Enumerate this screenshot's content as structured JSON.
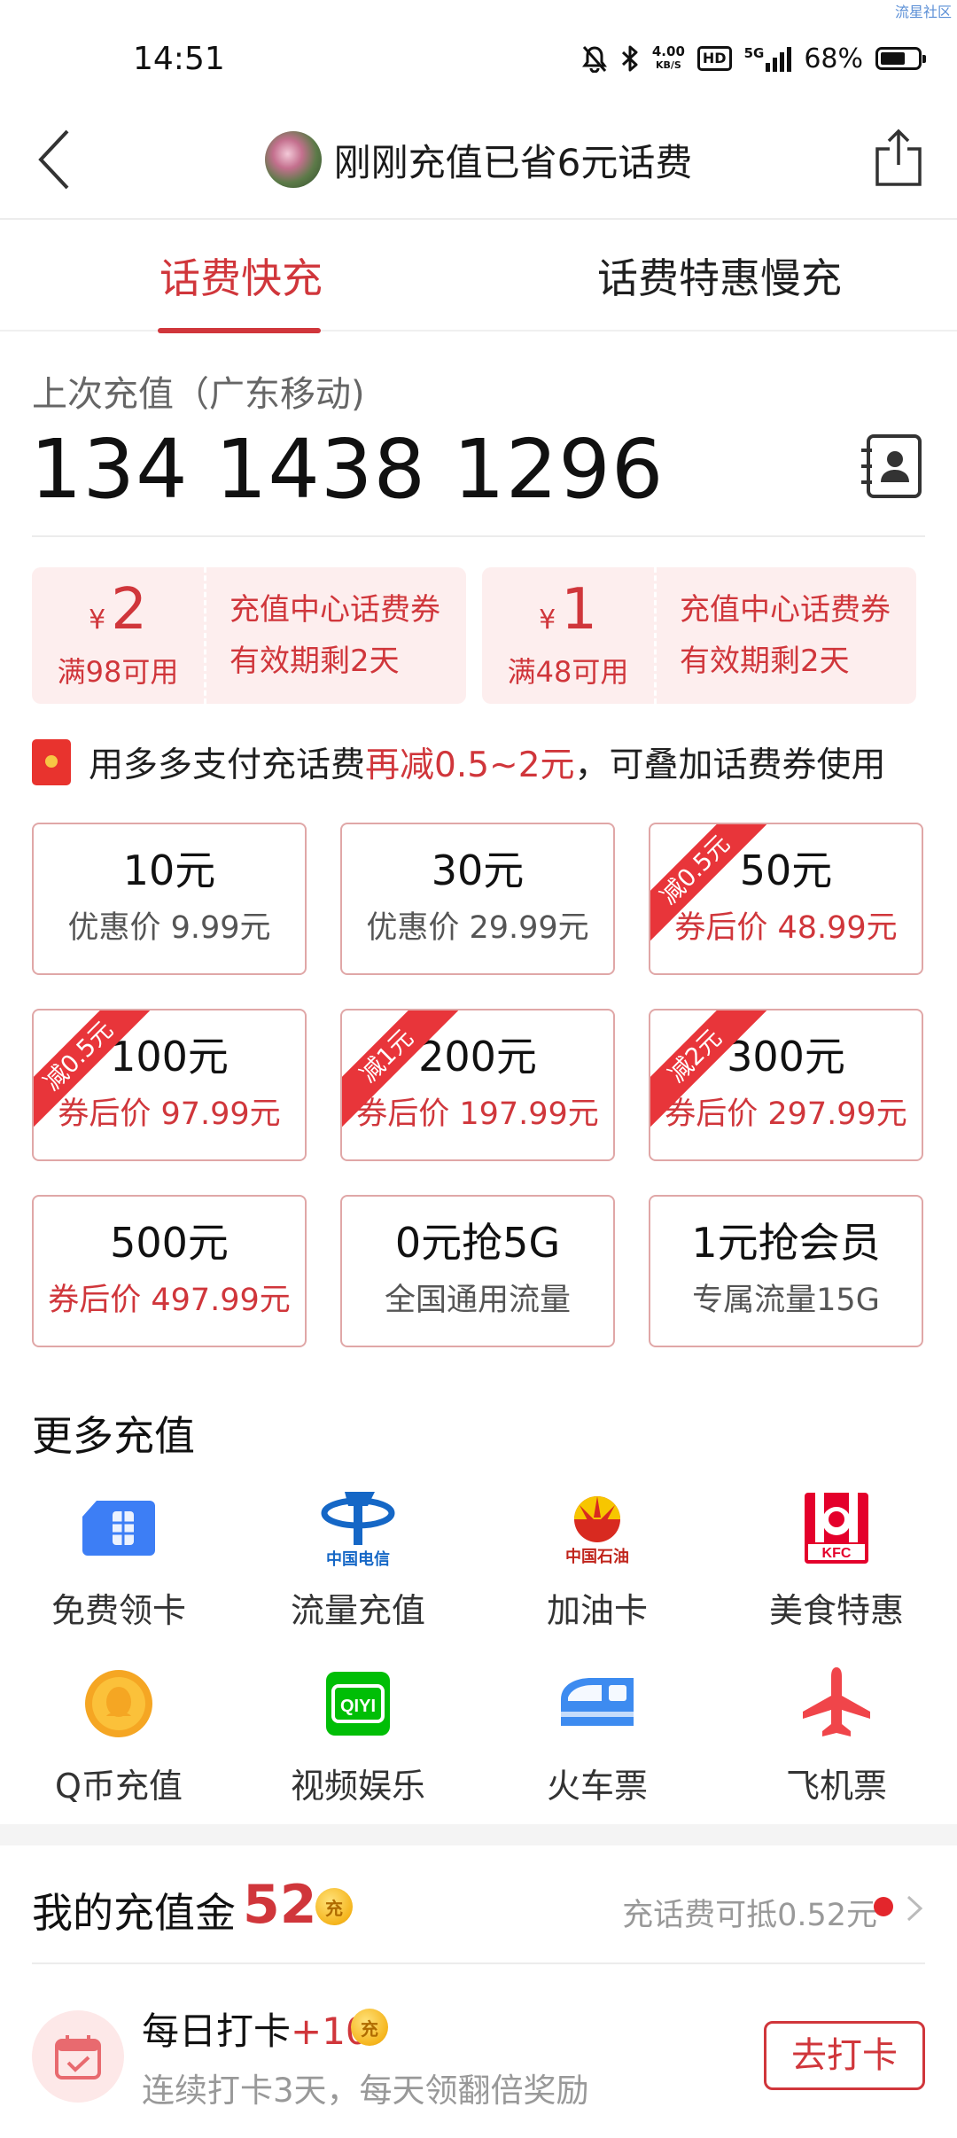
{
  "status_bar": {
    "time": "14:51",
    "net_speed_value": "4.00",
    "net_speed_unit": "KB/S",
    "hd": "HD",
    "network": "5G",
    "battery": "68%",
    "battery_level": 0.68,
    "watermark": "流星社区",
    "icons": [
      "mute-bell-icon",
      "bluetooth-icon",
      "signal-icon",
      "battery-icon"
    ]
  },
  "header": {
    "title": "刚刚充值已省6元话费",
    "icons": [
      "back-arrow-icon",
      "avatar",
      "share-icon"
    ]
  },
  "tabs": [
    {
      "label": "话费快充",
      "active": true
    },
    {
      "label": "话费特惠慢充",
      "active": false
    }
  ],
  "phone_section": {
    "label": "上次充值（广东移动)",
    "number": "134 1438 1296",
    "icon": "contacts-icon"
  },
  "coupons": [
    {
      "symbol": "¥",
      "amount": "2",
      "condition": "满98可用",
      "line1": "充值中心话费券",
      "line2": "有效期剩2天"
    },
    {
      "symbol": "¥",
      "amount": "1",
      "condition": "满48可用",
      "line1": "充值中心话费券",
      "line2": "有效期剩2天"
    }
  ],
  "promo": {
    "text_before": "用多多支付充话费",
    "highlight": "再减0.5~2元",
    "text_after": "，可叠加话费券使用",
    "icon": "red-envelope-icon"
  },
  "recharge_options": [
    {
      "main": "10元",
      "sub": "优惠价 9.99元",
      "ribbon": ""
    },
    {
      "main": "30元",
      "sub": "优惠价 29.99元",
      "ribbon": ""
    },
    {
      "main": "50元",
      "sub": "券后价 48.99元",
      "ribbon": "减0.5元"
    },
    {
      "main": "100元",
      "sub": "券后价 97.99元",
      "ribbon": "减0.5元"
    },
    {
      "main": "200元",
      "sub": "券后价 197.99元",
      "ribbon": "减1元"
    },
    {
      "main": "300元",
      "sub": "券后价 297.99元",
      "ribbon": "减2元"
    },
    {
      "main": "500元",
      "sub": "券后价 497.99元",
      "ribbon": ""
    },
    {
      "main": "0元抢5G",
      "sub": "全国通用流量",
      "ribbon": ""
    },
    {
      "main": "1元抢会员",
      "sub": "专属流量15G",
      "ribbon": ""
    }
  ],
  "more_recharge": {
    "title": "更多充值",
    "items": [
      {
        "label": "免费领卡",
        "icon": "sim-card-icon"
      },
      {
        "label": "流量充值",
        "icon": "china-telecom-logo",
        "logo_text": "中国电信"
      },
      {
        "label": "加油卡",
        "icon": "sinopec-logo",
        "logo_text": "中国石油"
      },
      {
        "label": "美食特惠",
        "icon": "kfc-logo",
        "logo_text": "KFC"
      },
      {
        "label": "Q币充值",
        "icon": "qq-coin-icon"
      },
      {
        "label": "视频娱乐",
        "icon": "iqiyi-logo",
        "logo_text": "QIYI"
      },
      {
        "label": "火车票",
        "icon": "train-icon"
      },
      {
        "label": "飞机票",
        "icon": "airplane-icon"
      }
    ]
  },
  "recharge_money": {
    "label": "我的充值金",
    "value": "52",
    "coin_glyph": "充",
    "hint": "充话费可抵0.52元"
  },
  "checkin": {
    "title": "每日打卡",
    "bonus": "+10",
    "coin_glyph": "充",
    "subtitle": "连续打卡3天，每天领翻倍奖励",
    "button": "去打卡"
  },
  "colors": {
    "accent": "#d0363b",
    "coupon_bg": "#fdeeee",
    "card_border": "#e0a7a7"
  }
}
